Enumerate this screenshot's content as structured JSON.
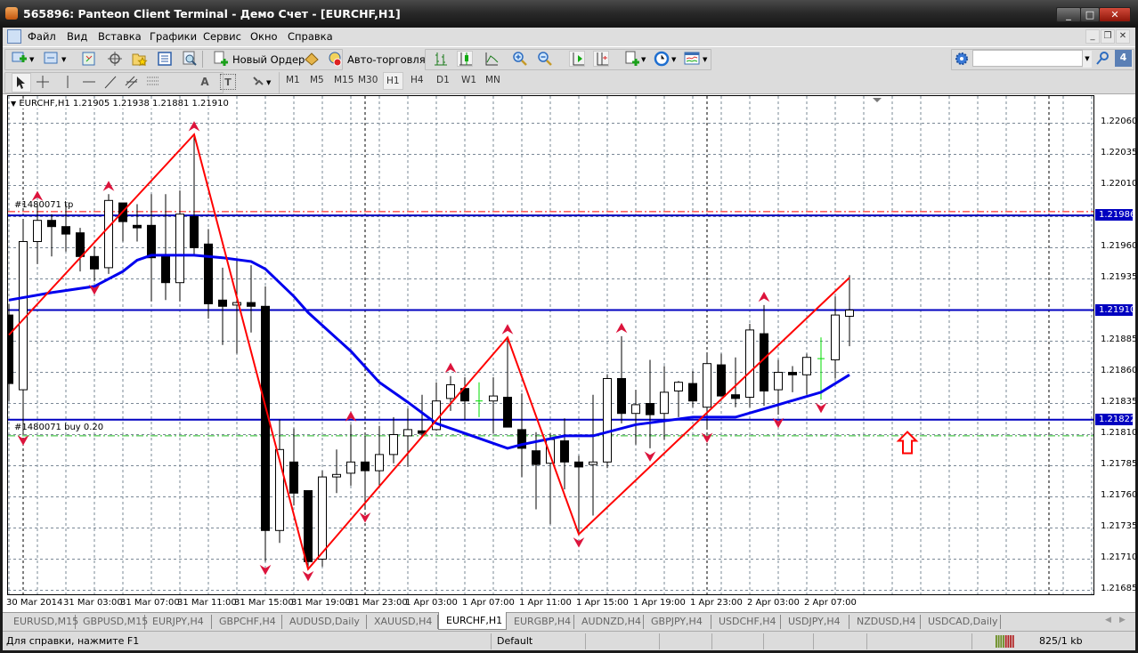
{
  "window": {
    "title": "565896: Panteon Client Terminal - Демо Счет - [EURCHF,H1]"
  },
  "menu": [
    "Файл",
    "Вид",
    "Вставка",
    "Графики",
    "Сервис",
    "Окно",
    "Справка"
  ],
  "toolbar": {
    "new_order": "Новый Ордер",
    "auto_trading": "Авто-торговля",
    "search_placeholder": "",
    "notifications_count": "4"
  },
  "timeframes": [
    "M1",
    "M5",
    "M15",
    "M30",
    "H1",
    "H4",
    "D1",
    "W1",
    "MN"
  ],
  "active_timeframe": "H1",
  "chart_data": {
    "type": "candlestick",
    "symbol_header": "EURCHF,H1  1.21905 1.21938 1.21881 1.21910",
    "ylim": [
      1.21685,
      1.2206
    ],
    "y_ticks": [
      "1.22060",
      "1.22035",
      "1.22010",
      "1.21960",
      "1.21935",
      "1.21885",
      "1.21860",
      "1.21835",
      "1.21810",
      "1.21785",
      "1.21760",
      "1.21735",
      "1.21710",
      "1.21685"
    ],
    "x_ticks": [
      "30 Mar 2014",
      "31 Mar 03:00",
      "31 Mar 07:00",
      "31 Mar 11:00",
      "31 Mar 15:00",
      "31 Mar 19:00",
      "31 Mar 23:00",
      "1 Apr 03:00",
      "1 Apr 07:00",
      "1 Apr 11:00",
      "1 Apr 15:00",
      "1 Apr 19:00",
      "1 Apr 23:00",
      "2 Apr 03:00",
      "2 Apr 07:00"
    ],
    "grid": true,
    "ohlc": [
      [
        1.21906,
        1.21915,
        1.21837,
        1.21851
      ],
      [
        1.21846,
        1.21983,
        1.21812,
        1.21965
      ],
      [
        1.21965,
        1.21995,
        1.21947,
        1.21982
      ],
      [
        1.21982,
        1.21987,
        1.21953,
        1.21977
      ],
      [
        1.21977,
        1.21995,
        1.21957,
        1.21971
      ],
      [
        1.21972,
        1.21976,
        1.21941,
        1.21953
      ],
      [
        1.21953,
        1.21961,
        1.21933,
        1.21943
      ],
      [
        1.21944,
        1.22003,
        1.21939,
        1.21998
      ],
      [
        1.21996,
        1.21996,
        1.21965,
        1.21981
      ],
      [
        1.21978,
        1.21995,
        1.21965,
        1.21976
      ],
      [
        1.21978,
        1.22003,
        1.21917,
        1.21952
      ],
      [
        1.21953,
        1.22003,
        1.21918,
        1.21932
      ],
      [
        1.21932,
        1.22006,
        1.21917,
        1.21987
      ],
      [
        1.21985,
        1.22051,
        1.21955,
        1.2196
      ],
      [
        1.21963,
        1.21975,
        1.21903,
        1.21915
      ],
      [
        1.21918,
        1.21944,
        1.21882,
        1.21913
      ],
      [
        1.21914,
        1.21951,
        1.21875,
        1.21916
      ],
      [
        1.21916,
        1.21946,
        1.21892,
        1.21913
      ],
      [
        1.21913,
        1.21929,
        1.21708,
        1.21733
      ],
      [
        1.21733,
        1.21822,
        1.21723,
        1.21798
      ],
      [
        1.21788,
        1.21815,
        1.21753,
        1.21763
      ],
      [
        1.21765,
        1.21765,
        1.21703,
        1.21708
      ],
      [
        1.2171,
        1.21781,
        1.21704,
        1.21776
      ],
      [
        1.21776,
        1.21798,
        1.21763,
        1.21778
      ],
      [
        1.21779,
        1.21818,
        1.21769,
        1.21788
      ],
      [
        1.21788,
        1.21809,
        1.2175,
        1.21781
      ],
      [
        1.21781,
        1.21817,
        1.21769,
        1.21794
      ],
      [
        1.21794,
        1.21824,
        1.21787,
        1.2181
      ],
      [
        1.21809,
        1.21831,
        1.21784,
        1.21814
      ],
      [
        1.21813,
        1.21842,
        1.21809,
        1.21811
      ],
      [
        1.21814,
        1.21852,
        1.21813,
        1.21837
      ],
      [
        1.21839,
        1.21857,
        1.21829,
        1.2185
      ],
      [
        1.21847,
        1.21856,
        1.21822,
        1.21837
      ],
      [
        1.21837,
        1.21852,
        1.21824,
        1.21837
      ],
      [
        1.21837,
        1.21856,
        1.21811,
        1.21841
      ],
      [
        1.2184,
        1.21888,
        1.21816,
        1.21816
      ],
      [
        1.21814,
        1.21843,
        1.21776,
        1.21799
      ],
      [
        1.21797,
        1.21812,
        1.2175,
        1.21786
      ],
      [
        1.21787,
        1.21811,
        1.21738,
        1.21806
      ],
      [
        1.21805,
        1.21823,
        1.21766,
        1.21788
      ],
      [
        1.21788,
        1.21793,
        1.2173,
        1.21784
      ],
      [
        1.21786,
        1.21842,
        1.21745,
        1.21788
      ],
      [
        1.21788,
        1.21858,
        1.21783,
        1.21855
      ],
      [
        1.21855,
        1.21889,
        1.21819,
        1.21827
      ],
      [
        1.21827,
        1.21846,
        1.21802,
        1.21834
      ],
      [
        1.21835,
        1.2187,
        1.21799,
        1.21826
      ],
      [
        1.21827,
        1.21865,
        1.21806,
        1.21844
      ],
      [
        1.21845,
        1.21853,
        1.21824,
        1.21852
      ],
      [
        1.21851,
        1.21861,
        1.21832,
        1.21837
      ],
      [
        1.21832,
        1.21874,
        1.21814,
        1.21867
      ],
      [
        1.21866,
        1.21875,
        1.21841,
        1.21841
      ],
      [
        1.21842,
        1.21872,
        1.21832,
        1.21839
      ],
      [
        1.2184,
        1.21899,
        1.21832,
        1.21894
      ],
      [
        1.21891,
        1.21914,
        1.21833,
        1.21845
      ],
      [
        1.21846,
        1.2187,
        1.21826,
        1.2186
      ],
      [
        1.2186,
        1.21865,
        1.21844,
        1.21858
      ],
      [
        1.21858,
        1.21875,
        1.21842,
        1.21872
      ],
      [
        1.21871,
        1.21888,
        1.21838,
        1.21871
      ],
      [
        1.2187,
        1.21921,
        1.21855,
        1.21906
      ],
      [
        1.21905,
        1.21938,
        1.21881,
        1.2191
      ]
    ],
    "moving_average": [
      [
        0,
        1.21918
      ],
      [
        3,
        1.21924
      ],
      [
        6,
        1.21929
      ],
      [
        8,
        1.21941
      ],
      [
        9,
        1.2195
      ],
      [
        10,
        1.21954
      ],
      [
        13,
        1.21954
      ],
      [
        15,
        1.21952
      ],
      [
        17,
        1.21949
      ],
      [
        18,
        1.21943
      ],
      [
        20,
        1.21921
      ],
      [
        21,
        1.21908
      ],
      [
        24,
        1.21877
      ],
      [
        26,
        1.21852
      ],
      [
        28,
        1.21836
      ],
      [
        30,
        1.21819
      ],
      [
        32,
        1.21811
      ],
      [
        35,
        1.21799
      ],
      [
        36,
        1.21802
      ],
      [
        39,
        1.21809
      ],
      [
        41,
        1.21809
      ],
      [
        44,
        1.21818
      ],
      [
        48,
        1.21824
      ],
      [
        51,
        1.21824
      ],
      [
        54,
        1.21834
      ],
      [
        57,
        1.21844
      ],
      [
        59,
        1.21858
      ]
    ],
    "zigzag": [
      [
        0,
        1.2189
      ],
      [
        13,
        1.22051
      ],
      [
        21,
        1.21702
      ],
      [
        35,
        1.21888
      ],
      [
        40,
        1.2173
      ],
      [
        59,
        1.21936
      ]
    ],
    "fractals_up": [
      2,
      7,
      13,
      24,
      31,
      35,
      43,
      53
    ],
    "fractals_down": [
      1,
      6,
      18,
      21,
      25,
      40,
      45,
      49,
      54,
      57
    ],
    "hlines": [
      {
        "price": 1.21986,
        "label": "1.21986",
        "color": "#0000c0"
      },
      {
        "price": 1.2191,
        "label": "1.21910",
        "color": "#0000c0"
      },
      {
        "price": 1.21822,
        "label": "1.21822",
        "color": "#0000c0"
      }
    ],
    "tp_line": {
      "price": 1.21989,
      "label": "#1480071 tp",
      "color": "#ff0000"
    },
    "order_line": {
      "price": 1.21809,
      "label": "#1480071 buy 0.20",
      "color": "#22bb22"
    },
    "buy_signal_arrow": {
      "price": 1.2181,
      "color": "#ff0000"
    },
    "day_separators": [
      1,
      25,
      49,
      73
    ],
    "colors": {
      "ma": "#0000ee",
      "zigzag": "#ff0000",
      "fractal": "#dc143c",
      "doji": "#00dd00"
    }
  },
  "tabs": [
    "EURUSD,M15",
    "GBPUSD,M15",
    "EURJPY,H4",
    "GBPCHF,H4",
    "AUDUSD,Daily",
    "XAUUSD,H4",
    "EURCHF,H1",
    "EURGBP,H4",
    "AUDNZD,H4",
    "GBPJPY,H4",
    "USDCHF,H4",
    "USDJPY,H4",
    "NZDUSD,H4",
    "USDCAD,Daily"
  ],
  "active_tab": "EURCHF,H1",
  "status": {
    "help": "Для справки, нажмите F1",
    "profile": "Default",
    "traffic": "825/1 kb"
  }
}
